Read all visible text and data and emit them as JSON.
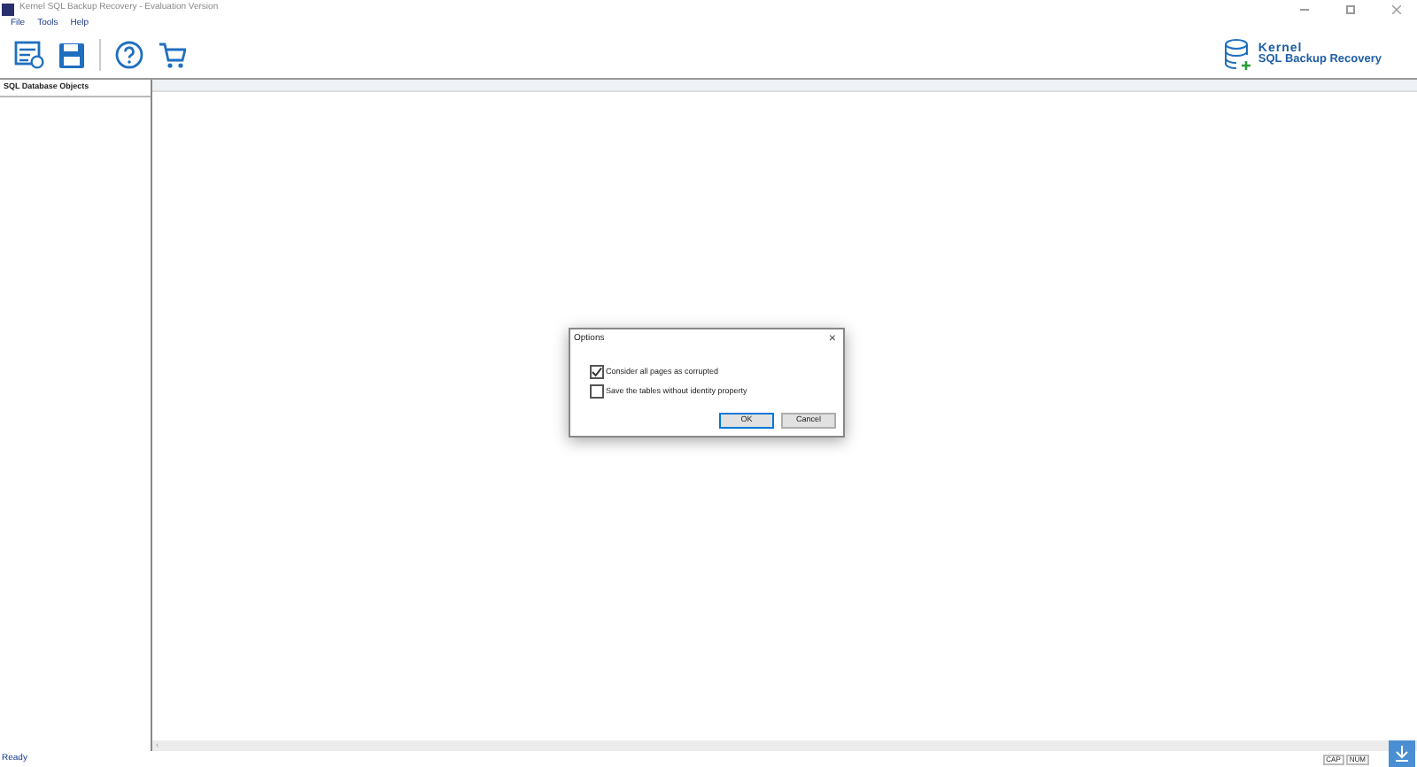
{
  "window": {
    "title": "Kernel SQL Backup Recovery - Evaluation Version"
  },
  "menu": [
    "File",
    "Tools",
    "Help"
  ],
  "logo": {
    "brand": "Kernel",
    "product": "SQL Backup Recovery"
  },
  "sidebar": {
    "title": "SQL Database Objects"
  },
  "dialog": {
    "title": "Options",
    "close": "×",
    "options": [
      {
        "label": "Consider all pages as corrupted",
        "checked": true
      },
      {
        "label": "Save the tables without identity property",
        "checked": false
      }
    ],
    "buttons": [
      "OK",
      "Cancel"
    ]
  },
  "scrollbar": {
    "arrow": "‹"
  },
  "status_bar": {
    "text": "Ready",
    "indicators": [
      "CAP",
      "NUM"
    ]
  }
}
